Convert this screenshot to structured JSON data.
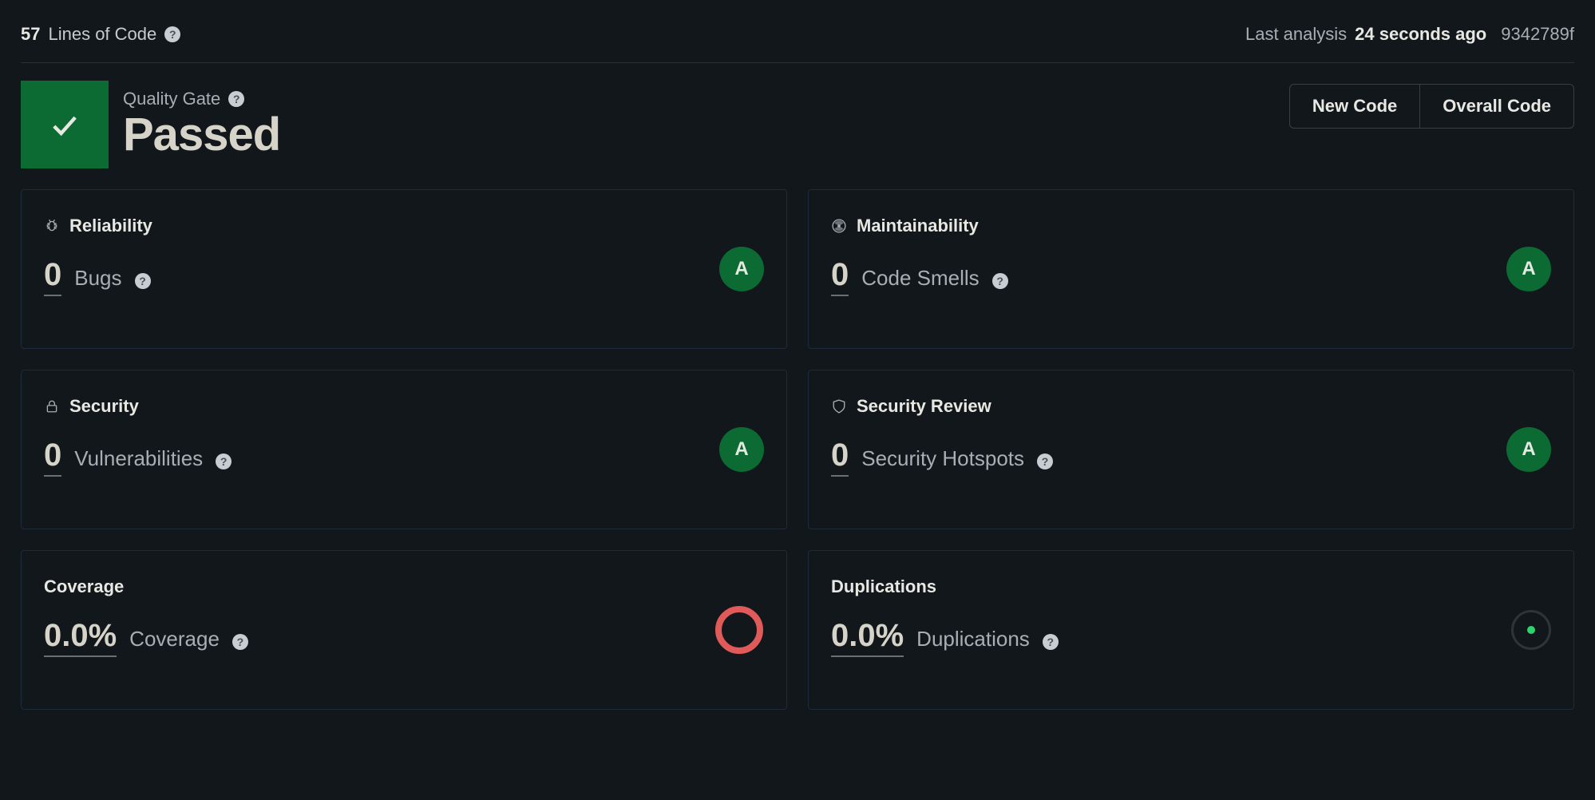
{
  "top": {
    "loc_count": "57",
    "loc_label": "Lines of Code",
    "analysis_prefix": "Last analysis",
    "analysis_ago": "24 seconds ago",
    "commit_sha": "9342789f"
  },
  "quality_gate": {
    "label": "Quality Gate",
    "status": "Passed"
  },
  "tabs": {
    "new_code": "New Code",
    "overall_code": "Overall Code"
  },
  "cards": {
    "reliability": {
      "title": "Reliability",
      "value": "0",
      "metric": "Bugs",
      "rating": "A"
    },
    "maintainability": {
      "title": "Maintainability",
      "value": "0",
      "metric": "Code Smells",
      "rating": "A"
    },
    "security": {
      "title": "Security",
      "value": "0",
      "metric": "Vulnerabilities",
      "rating": "A"
    },
    "security_review": {
      "title": "Security Review",
      "value": "0",
      "metric": "Security Hotspots",
      "rating": "A"
    },
    "coverage": {
      "title": "Coverage",
      "value": "0.0%",
      "metric": "Coverage"
    },
    "duplications": {
      "title": "Duplications",
      "value": "0.0%",
      "metric": "Duplications"
    }
  }
}
